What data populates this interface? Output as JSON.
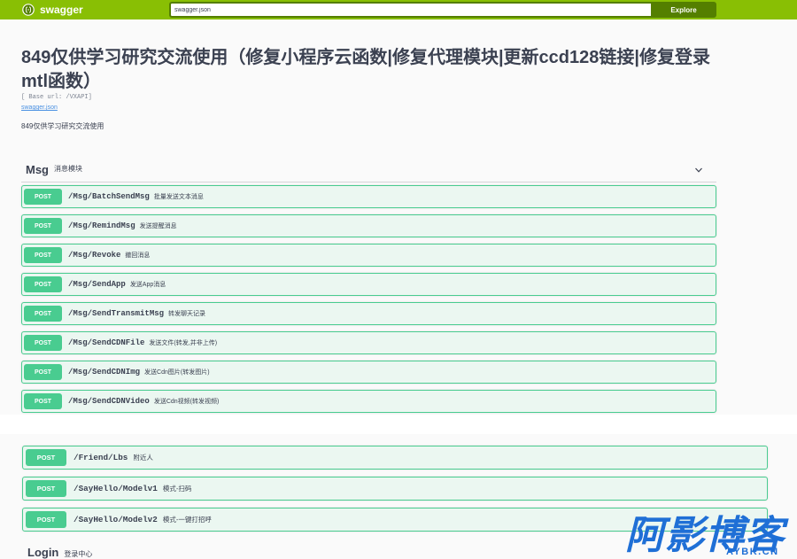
{
  "theme": {
    "topbar_bg": "#89bf04",
    "explore_bg": "#547f00",
    "post_color": "#49cc90",
    "post_bg": "#ebf7f1",
    "text_color": "#3b4151",
    "link_color": "#4990e2",
    "watermark_color": "#1f6fd6"
  },
  "topbar": {
    "logo_icon": "swagger-logo-icon",
    "logo_text": "swagger",
    "url_value": "swagger.json",
    "explore_label": "Explore"
  },
  "info": {
    "title": "849仅供学习研究交流使用（修复小程序云函数|修复代理模块|更新ccd128链接|修复登录mtl函数）",
    "base_url": "[ Base url: /VXAPI]",
    "spec_link": "swagger.json",
    "description": "849仅供学习研究交流使用"
  },
  "msg_section": {
    "tag": "Msg",
    "tag_description": "消息模块",
    "toggle_icon": "chevron-down-icon",
    "operations": [
      {
        "method": "POST",
        "path": "/Msg/BatchSendMsg",
        "summary": "批量发送文本消息"
      },
      {
        "method": "POST",
        "path": "/Msg/RemindMsg",
        "summary": "发送提醒消息"
      },
      {
        "method": "POST",
        "path": "/Msg/Revoke",
        "summary": "撤回消息"
      },
      {
        "method": "POST",
        "path": "/Msg/SendApp",
        "summary": "发送App消息"
      },
      {
        "method": "POST",
        "path": "/Msg/SendTransmitMsg",
        "summary": "转发聊天记录"
      },
      {
        "method": "POST",
        "path": "/Msg/SendCDNFile",
        "summary": "发送文件(转发,并非上传)"
      },
      {
        "method": "POST",
        "path": "/Msg/SendCDNImg",
        "summary": "发送Cdn图片(转发图片)"
      },
      {
        "method": "POST",
        "path": "/Msg/SendCDNVideo",
        "summary": "发送Cdn视频(转发视频)"
      }
    ]
  },
  "lower_section": {
    "operations": [
      {
        "method": "POST",
        "path": "/Friend/Lbs",
        "summary": "附近人"
      },
      {
        "method": "POST",
        "path": "/SayHello/Modelv1",
        "summary": "模式-扫码"
      },
      {
        "method": "POST",
        "path": "/SayHello/Modelv2",
        "summary": "模式-一键打招呼"
      }
    ]
  },
  "login_section": {
    "tag": "Login",
    "tag_description": "登录中心"
  },
  "watermark": {
    "name": "阿影博客",
    "domain": "AYBK.CN"
  }
}
